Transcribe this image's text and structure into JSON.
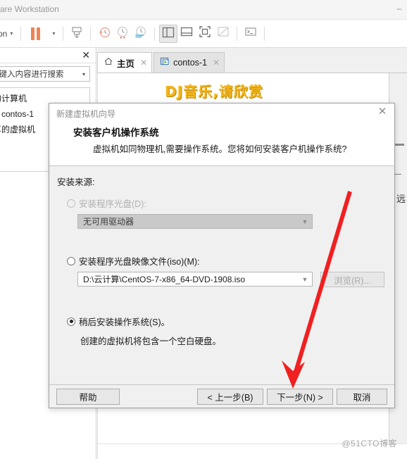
{
  "window": {
    "title": "are Workstation",
    "minimize_icon": "minimize-icon"
  },
  "toolbar": {
    "menu_label": "tion",
    "caret": "▾",
    "items": [
      {
        "name": "pause-button",
        "icon": "pause-icon"
      },
      {
        "name": "pause-dropdown",
        "icon": "chevron-down-icon"
      },
      {
        "name": "send-key-button",
        "icon": "send-ctrl-alt-del-icon"
      },
      {
        "name": "snapshot-take-button",
        "icon": "snapshot-clock-icon"
      },
      {
        "name": "snapshot-revert-button",
        "icon": "snapshot-revert-icon"
      },
      {
        "name": "snapshot-manager-button",
        "icon": "snapshot-manager-icon"
      },
      {
        "name": "show-library-button",
        "icon": "sidebar-layout-icon"
      },
      {
        "name": "show-console-view-button",
        "icon": "bottom-panel-icon"
      },
      {
        "name": "fullscreen-button",
        "icon": "fullscreen-icon"
      },
      {
        "name": "unity-mode-button",
        "icon": "unity-mode-disabled-icon"
      },
      {
        "name": "console-button",
        "icon": "terminal-icon"
      }
    ]
  },
  "library": {
    "close_label": "✕",
    "search_placeholder": "处键入内容进行搜索",
    "dropdown_caret": "▾",
    "tree": [
      {
        "label": "的计算机"
      },
      {
        "label": "contos-1"
      },
      {
        "label": "享的虚拟机"
      }
    ]
  },
  "tabs": [
    {
      "label": "主页",
      "icon": "home-icon",
      "close": "✕",
      "active": true
    },
    {
      "label": "contos-1",
      "icon": "vm-running-icon",
      "close": "✕",
      "active": false
    }
  ],
  "content": {
    "banner_text": "DJ音乐,请欣赏",
    "banner_color": "#f3b41b",
    "right_back_icon": "←",
    "right_word": "远",
    "watermark": "@51CTO博客"
  },
  "dialog": {
    "title": "新建虚拟机向导",
    "close_label": "✕",
    "heading": "安装客户机操作系统",
    "subheading": "虚拟机如同物理机,需要操作系统。您将如何安装客户机操作系统?",
    "section_label": "安装来源:",
    "options": [
      {
        "id": "installer-disc",
        "label": "安装程序光盘(D):",
        "selected": false,
        "disabled": true,
        "combo_value": "无可用驱动器",
        "combo_disabled": true
      },
      {
        "id": "installer-iso",
        "label": "安装程序光盘映像文件(iso)(M):",
        "selected": false,
        "disabled": false,
        "combo_value": "D:\\云计算\\CentOS-7-x86_64-DVD-1908.iso",
        "combo_disabled": false,
        "browse_label": "浏览(R)...",
        "browse_disabled": true
      },
      {
        "id": "install-later",
        "label": "稍后安装操作系统(S)。",
        "selected": true,
        "disabled": false,
        "hint": "创建的虚拟机将包含一个空白硬盘。"
      }
    ],
    "buttons": {
      "help": "帮助",
      "back": "< 上一步(B)",
      "next": "下一步(N) >",
      "cancel": "取消"
    }
  },
  "annotation": {
    "arrow_color": "#f02020",
    "arrow_target": "下一步(N) >"
  }
}
